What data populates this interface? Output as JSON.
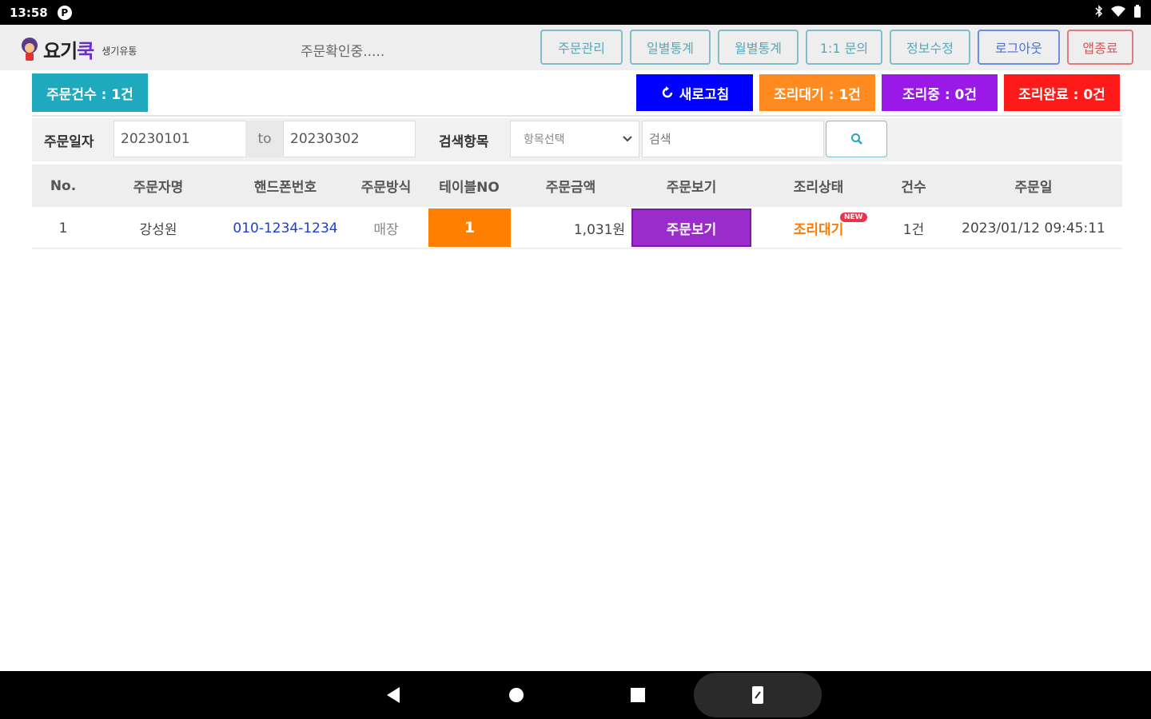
{
  "status_bar": {
    "time": "13:58",
    "app_icon": "P"
  },
  "header": {
    "brand": "요기",
    "brand_accent": "쿡",
    "sub": "생기유통",
    "notice": "주문확인중.....",
    "nav": [
      {
        "label": "주문관리",
        "style": "teal"
      },
      {
        "label": "일별통계",
        "style": "teal"
      },
      {
        "label": "월별통계",
        "style": "teal"
      },
      {
        "label": "1:1 문의",
        "style": "teal"
      },
      {
        "label": "정보수정",
        "style": "teal"
      },
      {
        "label": "로그아웃",
        "style": "blue"
      },
      {
        "label": "앱종료",
        "style": "red"
      }
    ]
  },
  "summary": {
    "order_count": "주문건수 : 1건",
    "refresh": "새로고침",
    "waiting": "조리대기 : 1건",
    "cooking": "조리중 : 0건",
    "done": "조리완료 : 0건"
  },
  "colors": {
    "teal": "#1ea9bf",
    "refresh": "#0000ff",
    "waiting": "#ff8a1f",
    "cooking": "#9b19e6",
    "done": "#ff1a1a",
    "table_no": "#ff8000",
    "view": "#9b2ccc"
  },
  "filter": {
    "date_label": "주문일자",
    "date_from": "20230101",
    "to_label": "to",
    "date_to": "20230302",
    "field_label": "검색항목",
    "field_select": "항목선택",
    "search_placeholder": "검색",
    "search_icon": "search-icon"
  },
  "table": {
    "headers": [
      "No.",
      "주문자명",
      "핸드폰번호",
      "주문방식",
      "테이블NO",
      "주문금액",
      "주문보기",
      "조리상태",
      "건수",
      "주문일"
    ],
    "rows": [
      {
        "no": "1",
        "name": "강성원",
        "phone": "010-1234-1234",
        "method": "매장",
        "table_no": "1",
        "amount": "1,031원",
        "view": "주문보기",
        "state": "조리대기",
        "new_badge": "NEW",
        "count": "1건",
        "date": "2023/01/12 09:45:11"
      }
    ]
  }
}
